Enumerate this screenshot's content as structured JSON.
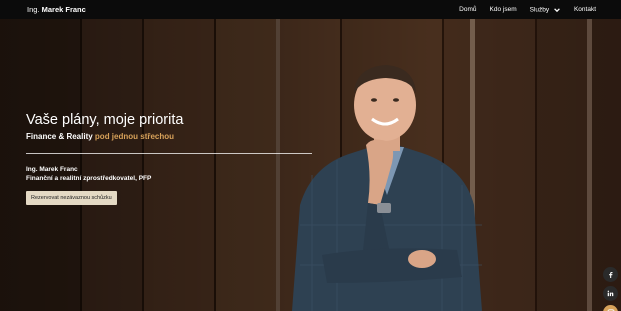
{
  "nav": {
    "brand_prefix": "Ing.",
    "brand_name": "Marek Franc",
    "items": [
      {
        "label": "Domů"
      },
      {
        "label": "Kdo jsem"
      },
      {
        "label": "Služby"
      },
      {
        "label": "Kontakt"
      }
    ]
  },
  "hero": {
    "headline": "Vaše plány, moje priorita",
    "subtitle_main": "Finance & Reality",
    "subtitle_accent": "pod jednou střechou",
    "person_name": "Ing. Marek Franc",
    "person_title": "Finanční a realitní zprostředkovatel, PFP",
    "cta_label": "Rezervovat nezávaznou schůzku"
  },
  "social": {
    "facebook_icon": "facebook-icon",
    "linkedin_icon": "linkedin-icon",
    "instagram_icon": "instagram-icon"
  },
  "colors": {
    "accent": "#d8a25a",
    "nav_bg": "#0b0b0b",
    "cta_bg": "#e4d9c4"
  }
}
